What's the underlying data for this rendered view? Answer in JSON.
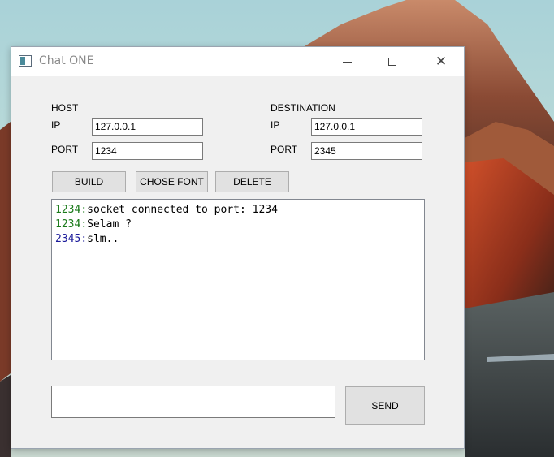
{
  "window": {
    "title": "Chat ONE",
    "app_icon": "window-app-icon",
    "controls": {
      "minimize_icon": "minimize-icon",
      "maximize_icon": "maximize-icon",
      "close_glyph": "✕"
    }
  },
  "host": {
    "heading": "HOST",
    "ip_label": "IP",
    "ip_value": "127.0.0.1",
    "port_label": "PORT",
    "port_value": "1234"
  },
  "destination": {
    "heading": "DESTINATION",
    "ip_label": "IP",
    "ip_value": "127.0.0.1",
    "port_label": "PORT",
    "port_value": "2345"
  },
  "toolbar": {
    "build_label": "BUILD",
    "font_label": "CHOSE FONT",
    "delete_label": "DELETE"
  },
  "chat": {
    "messages": [
      {
        "port": "1234",
        "sep": ":",
        "text": "socket connected to port: 1234",
        "color": "#1a7a1a"
      },
      {
        "port": "1234",
        "sep": ":",
        "text": "Selam ?",
        "color": "#1a7a1a"
      },
      {
        "port": "2345",
        "sep": ":",
        "text": "slm..",
        "color": "#1a1a9a"
      }
    ]
  },
  "compose": {
    "value": "",
    "send_label": "SEND"
  }
}
